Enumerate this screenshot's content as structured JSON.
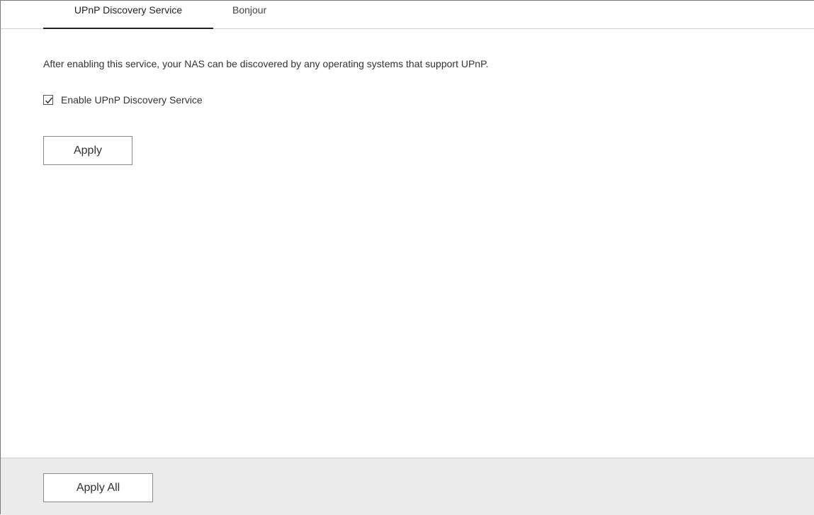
{
  "tabs": [
    {
      "label": "UPnP Discovery Service",
      "active": true
    },
    {
      "label": "Bonjour",
      "active": false
    }
  ],
  "main": {
    "description": "After enabling this service, your NAS can be discovered by any operating systems that support UPnP.",
    "checkbox": {
      "label": "Enable UPnP Discovery Service",
      "checked": true
    },
    "apply_label": "Apply"
  },
  "footer": {
    "apply_all_label": "Apply All"
  },
  "colors": {
    "footer_background": "#ebebeb",
    "active_tab_underline": "#222222",
    "button_border": "#8a8a8a"
  },
  "icons": {
    "checkbox_mark": "checkmark-icon"
  }
}
